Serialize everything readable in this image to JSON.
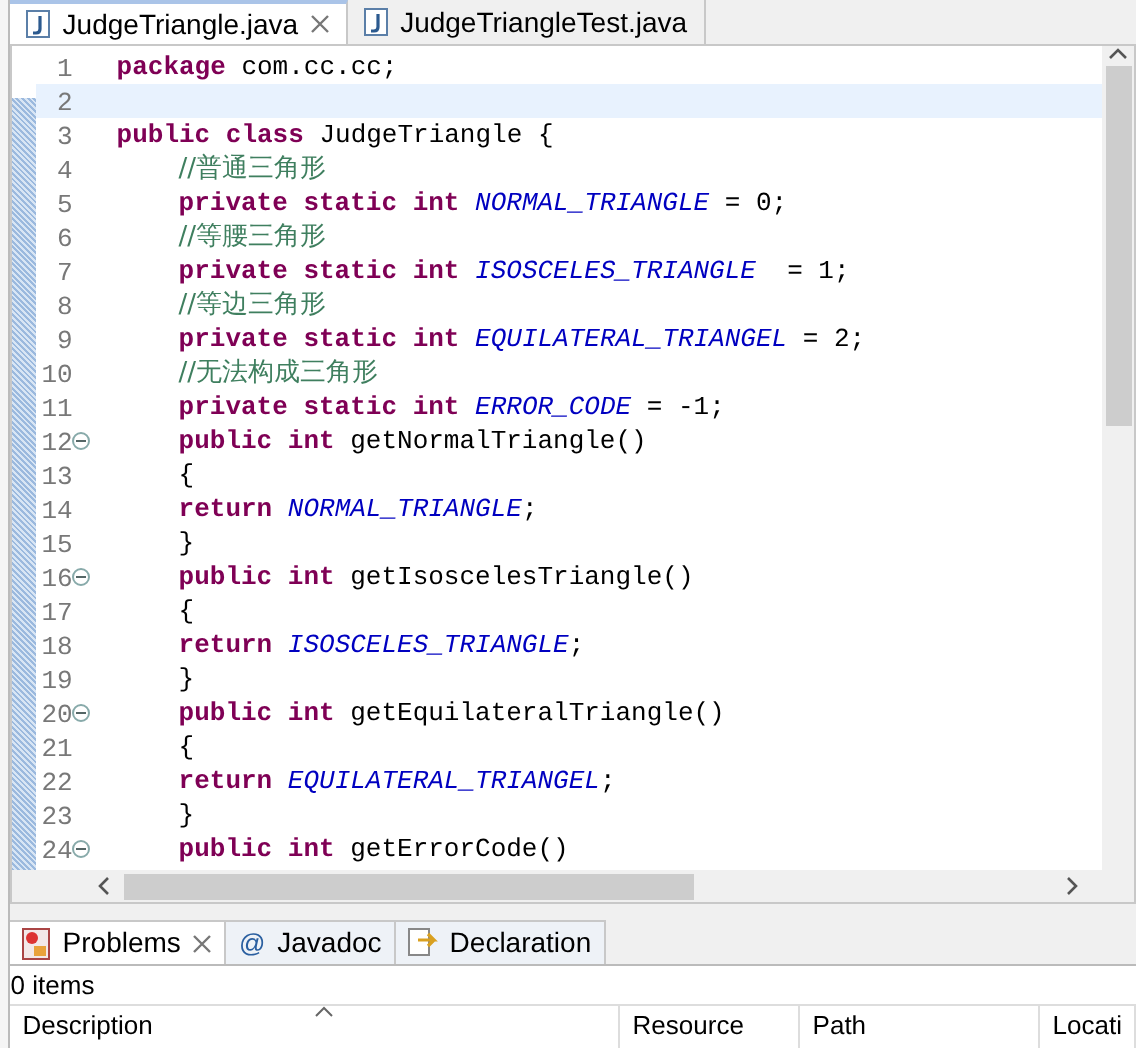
{
  "editor_tabs": [
    {
      "label": "JudgeTriangle.java",
      "selected": true,
      "closable": true
    },
    {
      "label": "JudgeTriangleTest.java",
      "selected": false,
      "closable": false
    }
  ],
  "code_lines": [
    {
      "number": "1",
      "fold": false,
      "current": false,
      "indented": false,
      "tokens": [
        {
          "kind": "keyword",
          "text": "package"
        },
        {
          "kind": "plain",
          "text": " com.cc.cc;"
        }
      ]
    },
    {
      "number": "2",
      "fold": false,
      "current": true
    },
    {
      "number": "3",
      "fold": false,
      "current": false,
      "indented": false,
      "tokens": [
        {
          "kind": "keyword",
          "text": "public class"
        },
        {
          "kind": "plain",
          "text": " JudgeTriangle {"
        }
      ]
    },
    {
      "number": "4",
      "fold": false,
      "current": false,
      "indented": true,
      "tokens": [
        {
          "kind": "comment",
          "text": "//普通三角形"
        }
      ]
    },
    {
      "number": "5",
      "fold": false,
      "current": false,
      "indented": true,
      "tokens": [
        {
          "kind": "keyword",
          "text": "private static int"
        },
        {
          "kind": "constant",
          "text": " NORMAL_TRIANGLE"
        },
        {
          "kind": "plain",
          "text": " = 0;"
        }
      ]
    },
    {
      "number": "6",
      "fold": false,
      "current": false,
      "indented": true,
      "tokens": [
        {
          "kind": "comment",
          "text": "//等腰三角形"
        }
      ]
    },
    {
      "number": "7",
      "fold": false,
      "current": false,
      "indented": true,
      "tokens": [
        {
          "kind": "keyword",
          "text": "private static int"
        },
        {
          "kind": "constant",
          "text": " ISOSCELES_TRIANGLE"
        },
        {
          "kind": "plain",
          "text": "  = 1;"
        }
      ]
    },
    {
      "number": "8",
      "fold": false,
      "current": false,
      "indented": true,
      "tokens": [
        {
          "kind": "comment",
          "text": "//等边三角形"
        }
      ]
    },
    {
      "number": "9",
      "fold": false,
      "current": false,
      "indented": true,
      "tokens": [
        {
          "kind": "keyword",
          "text": "private static int"
        },
        {
          "kind": "constant",
          "text": " EQUILATERAL_TRIANGEL"
        },
        {
          "kind": "plain",
          "text": " = 2;"
        }
      ]
    },
    {
      "number": "10",
      "fold": false,
      "current": false,
      "indented": true,
      "tokens": [
        {
          "kind": "comment",
          "text": "//无法构成三角形"
        }
      ]
    },
    {
      "number": "11",
      "fold": false,
      "current": false,
      "indented": true,
      "tokens": [
        {
          "kind": "keyword",
          "text": "private static int"
        },
        {
          "kind": "constant",
          "text": " ERROR_CODE"
        },
        {
          "kind": "plain",
          "text": " = -1;"
        }
      ]
    },
    {
      "number": "12",
      "fold": true,
      "current": false,
      "indented": true,
      "tokens": [
        {
          "kind": "keyword",
          "text": "public int"
        },
        {
          "kind": "plain",
          "text": " getNormalTriangle()"
        }
      ]
    },
    {
      "number": "13",
      "fold": false,
      "current": false,
      "indented": true,
      "tokens": [
        {
          "kind": "plain",
          "text": "{"
        }
      ]
    },
    {
      "number": "14",
      "fold": false,
      "current": false,
      "indented": true,
      "tokens": [
        {
          "kind": "keyword",
          "text": "return"
        },
        {
          "kind": "constant",
          "text": " NORMAL_TRIANGLE"
        },
        {
          "kind": "plain",
          "text": ";"
        }
      ]
    },
    {
      "number": "15",
      "fold": false,
      "current": false,
      "indented": true,
      "tokens": [
        {
          "kind": "plain",
          "text": "}"
        }
      ]
    },
    {
      "number": "16",
      "fold": true,
      "current": false,
      "indented": true,
      "tokens": [
        {
          "kind": "keyword",
          "text": "public int"
        },
        {
          "kind": "plain",
          "text": " getIsoscelesTriangle()"
        }
      ]
    },
    {
      "number": "17",
      "fold": false,
      "current": false,
      "indented": true,
      "tokens": [
        {
          "kind": "plain",
          "text": "{"
        }
      ]
    },
    {
      "number": "18",
      "fold": false,
      "current": false,
      "indented": true,
      "tokens": [
        {
          "kind": "keyword",
          "text": "return"
        },
        {
          "kind": "constant",
          "text": " ISOSCELES_TRIANGLE"
        },
        {
          "kind": "plain",
          "text": ";"
        }
      ]
    },
    {
      "number": "19",
      "fold": false,
      "current": false,
      "indented": true,
      "tokens": [
        {
          "kind": "plain",
          "text": "}"
        }
      ]
    },
    {
      "number": "20",
      "fold": true,
      "current": false,
      "indented": true,
      "tokens": [
        {
          "kind": "keyword",
          "text": "public int"
        },
        {
          "kind": "plain",
          "text": " getEquilateralTriangle()"
        }
      ]
    },
    {
      "number": "21",
      "fold": false,
      "current": false,
      "indented": true,
      "tokens": [
        {
          "kind": "plain",
          "text": "{"
        }
      ]
    },
    {
      "number": "22",
      "fold": false,
      "current": false,
      "indented": true,
      "tokens": [
        {
          "kind": "keyword",
          "text": "return"
        },
        {
          "kind": "constant",
          "text": " EQUILATERAL_TRIANGEL"
        },
        {
          "kind": "plain",
          "text": ";"
        }
      ]
    },
    {
      "number": "23",
      "fold": false,
      "current": false,
      "indented": true,
      "tokens": [
        {
          "kind": "plain",
          "text": "}"
        }
      ]
    },
    {
      "number": "24",
      "fold": true,
      "current": false,
      "indented": true,
      "tokens": [
        {
          "kind": "keyword",
          "text": "public int"
        },
        {
          "kind": "plain",
          "text": " getErrorCode()"
        }
      ]
    }
  ],
  "view_tabs": [
    {
      "label": "Problems",
      "selected": true,
      "closable": true
    },
    {
      "label": "Javadoc",
      "glyph": "@",
      "selected": false,
      "closable": false
    },
    {
      "label": "Declaration",
      "selected": false,
      "closable": false
    }
  ],
  "status": "0 items",
  "table": {
    "columns": [
      {
        "label": "Description",
        "sorted": true
      },
      {
        "label": "Resource",
        "sorted": false
      },
      {
        "label": "Path",
        "sorted": false
      },
      {
        "label": "Locati",
        "sorted": false
      }
    ]
  }
}
